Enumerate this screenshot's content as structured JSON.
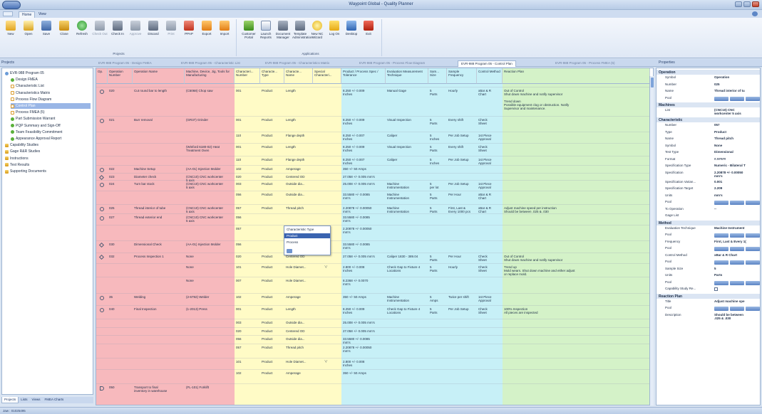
{
  "window": {
    "title": "Waypoint Global - Quality Planner"
  },
  "ribbon_tabs": [
    "Home",
    "View"
  ],
  "ribbon": {
    "projects_buttons": [
      {
        "label": "New",
        "icon": "new-folder-icon",
        "disabled": false
      },
      {
        "label": "Open",
        "icon": "open-folder-icon",
        "disabled": false
      },
      {
        "label": "Save",
        "icon": "save-icon",
        "disabled": false
      },
      {
        "label": "Close",
        "icon": "close-folder-icon",
        "disabled": false
      },
      {
        "label": "Refresh",
        "icon": "refresh-icon",
        "disabled": false
      },
      {
        "label": "Check Out",
        "icon": "check-out-icon",
        "disabled": true
      },
      {
        "label": "Check In",
        "icon": "check-in-icon",
        "disabled": false
      },
      {
        "label": "Approve",
        "icon": "approve-icon",
        "disabled": true
      },
      {
        "label": "Discard",
        "icon": "discard-icon",
        "disabled": false
      },
      {
        "label": "Print",
        "icon": "print-icon",
        "disabled": true
      },
      {
        "label": "PPAP",
        "icon": "ppap-icon",
        "disabled": false
      },
      {
        "label": "Export",
        "icon": "export-icon",
        "disabled": false
      },
      {
        "label": "Import",
        "icon": "import-icon",
        "disabled": false
      }
    ],
    "projects_group_label": "Projects",
    "applications_buttons": [
      {
        "label": "Customer Portal",
        "icon": "customer-portal-icon"
      },
      {
        "label": "Launch Reports",
        "icon": "launch-reports-icon"
      },
      {
        "label": "Document Manager",
        "icon": "document-manager-icon"
      },
      {
        "label": "Template Administration",
        "icon": "template-admin-icon"
      },
      {
        "label": "New NC Wizard",
        "icon": "nc-wizard-icon"
      },
      {
        "label": "Log On",
        "icon": "log-on-icon"
      },
      {
        "label": "Desktop",
        "icon": "desktop-icon"
      },
      {
        "label": "Exit",
        "icon": "exit-icon"
      }
    ],
    "applications_group_label": "Applications"
  },
  "projects_panel": {
    "header": "Projects",
    "tree": [
      {
        "label": "EVR-988 Program 05",
        "level": 0,
        "icon": "proj"
      },
      {
        "label": "Design FMEA",
        "level": 1,
        "icon": "green"
      },
      {
        "label": "Characteristic List",
        "level": 1,
        "icon": "doc"
      },
      {
        "label": "Characteristics Matrix",
        "level": 1,
        "icon": "doc"
      },
      {
        "label": "Process Flow Diagram",
        "level": 1,
        "icon": "doc"
      },
      {
        "label": "Control Plan",
        "level": 1,
        "icon": "doc",
        "selected": true
      },
      {
        "label": "Process FMEA (5)",
        "level": 1,
        "icon": "doc"
      },
      {
        "label": "Part Submission Warrant",
        "level": 1,
        "icon": "green"
      },
      {
        "label": "PQP Summary and Sign-Off",
        "level": 1,
        "icon": "green"
      },
      {
        "label": "Team Feasibility Commitment",
        "level": 1,
        "icon": "green"
      },
      {
        "label": "Appearance Approval Report",
        "level": 1,
        "icon": "green"
      },
      {
        "label": "Capability Studies",
        "level": 0,
        "icon": "folder"
      },
      {
        "label": "Gage R&R Studies",
        "level": 0,
        "icon": "folder"
      },
      {
        "label": "Instructions",
        "level": 0,
        "icon": "folder"
      },
      {
        "label": "Test Results",
        "level": 0,
        "icon": "folder"
      },
      {
        "label": "Supporting Documents",
        "level": 0,
        "icon": "folder"
      }
    ],
    "bottom_tabs": [
      "Projects",
      "Lists",
      "Views",
      "FMEA Charts"
    ]
  },
  "doc_tabs": [
    {
      "label": "EVR-988 Program 05 - Design FMEA",
      "active": false
    },
    {
      "label": "EVR-988 Program 05 - Characteristic List",
      "active": false
    },
    {
      "label": "EVR-988 Program 05 - Characteristics Matrix",
      "active": false
    },
    {
      "label": "EVR-988 Program 05 - Process Flow Diagram",
      "active": false
    },
    {
      "label": "EVR-988 Program 05 - Control Plan",
      "active": true
    },
    {
      "label": "EVR-988 Program 05 - Process FMEA (5)",
      "active": false
    }
  ],
  "grid": {
    "columns": [
      "Op.",
      "Operation Number",
      "Operation Name",
      "Machine, Device, Jig, Tools for Manufacturing",
      "Characteri... Number",
      "Characte... Type",
      "Characte... Name",
      "Special Characteri...",
      "Product / Process Spec / Tolerance",
      "Evaluation Measurement Technique",
      "Sam... Size",
      "Sample Frequency",
      "Control Method",
      "Reaction Plan"
    ],
    "rows": [
      {
        "mark": "circle",
        "opnum": "020",
        "opname": "Cut round bar to length",
        "machine": "(C5068) Chop saw",
        "charnum": "001",
        "type": "Product",
        "name": "Length",
        "special": "",
        "spec": "8.250 +/- 0.009\nInches",
        "eval": "Manual Gage",
        "size": "5\nParts",
        "freq": "Hourly",
        "control": "xBar & R\nChart",
        "reaction": "Out of Control\nShut down machine and notify supervisor\n\nTrend down\nPossible equipment clog or obstruction. Notify\nSupervisor and maintenance."
      },
      {
        "mark": "circle",
        "opnum": "021",
        "opname": "Burr removal",
        "machine": "(GR37) Grinder",
        "charnum": "001",
        "type": "Product",
        "name": "Length",
        "special": "",
        "spec": "8.250 +/- 0.009\nInches",
        "eval": "Visual Inspection",
        "size": "5\nParts",
        "freq": "Every shift",
        "control": "Check\nSheet",
        "reaction": ""
      },
      {
        "mark": "",
        "opnum": "",
        "opname": "",
        "machine": "",
        "charnum": "110",
        "type": "Product",
        "name": "Flange depth",
        "special": "",
        "spec": "8.250 +/- 0.007\nInches",
        "eval": "Caliper",
        "size": "5\nInches",
        "freq": "Per Job Setup",
        "control": "1st Piece\nApproval",
        "reaction": ""
      },
      {
        "mark": "",
        "opnum": "",
        "opname": "",
        "machine": "(Winford 6180-02) Heat\nTreatment Oven",
        "charnum": "001",
        "type": "Product",
        "name": "Length",
        "special": "",
        "spec": "8.250 +/- 0.009\nInches",
        "eval": "Visual Inspection",
        "size": "5\nParts",
        "freq": "Every shift",
        "control": "Check\nSheet",
        "reaction": ""
      },
      {
        "mark": "",
        "opnum": "",
        "opname": "",
        "machine": "",
        "charnum": "110",
        "type": "Product",
        "name": "Flange depth",
        "special": "",
        "spec": "8.250 +/- 0.007\nInches",
        "eval": "Caliper",
        "size": "5\nInches",
        "freq": "Per Job Setup",
        "control": "1st Piece\nApproval",
        "reaction": ""
      },
      {
        "mark": "circle",
        "opnum": "022",
        "opname": "Machine Setup",
        "machine": "(AA-01) Injection Molder",
        "charnum": "102",
        "type": "Product",
        "name": "Amperage",
        "special": "",
        "spec": "350 +/- 50 Amps",
        "eval": "",
        "size": "",
        "freq": "",
        "control": "",
        "reaction": ""
      },
      {
        "mark": "dia",
        "opnum": "023",
        "opname": "Diameter check",
        "machine": "(CNC10) CNC workcenter\n5 axis",
        "charnum": "020",
        "type": "Product",
        "name": "Centered OD",
        "special": "",
        "spec": "27.058 +/- 0.005 mm's",
        "eval": "",
        "size": "",
        "freq": "",
        "control": "",
        "reaction": ""
      },
      {
        "mark": "circle",
        "opnum": "024",
        "opname": "Turn bar stock",
        "machine": "(CNC10) CNC workcenter\n5 axis",
        "charnum": "003",
        "type": "Product",
        "name": "Outside dia...",
        "special": "",
        "spec": "25.008 +/- 0.005 mm's",
        "eval": "Machine\nInstrumentation",
        "size": "5\nper lot",
        "freq": "Per Job Setup",
        "control": "1st Piece\nApproval",
        "reaction": ""
      },
      {
        "mark": "",
        "opnum": "",
        "opname": "",
        "machine": "",
        "charnum": "056",
        "type": "Product",
        "name": "Outside dia...",
        "special": "",
        "spec": "33.5580 +/- 0.0085\nmm's",
        "eval": "Machine\nInstrumentation",
        "size": "5\nParts",
        "freq": "Per Hour",
        "control": "xBar & R\nChart",
        "reaction": ""
      },
      {
        "mark": "circle",
        "opnum": "025",
        "opname": "Thread interior of tube",
        "machine": "(CNC10) CNC workcenter\n5 axis",
        "charnum": "057",
        "type": "Product",
        "name": "Thread pitch",
        "special": "",
        "spec": "2.20878 +/- 0.00050\nmm's",
        "eval": "Machine\nInstrumentation",
        "size": "5\nParts",
        "freq": "First, Last &\nEvery 1000 pcs",
        "control": "xBar & R\nChart",
        "reaction": "Adjust machine speed per instruction\nShould be between .025 & .030"
      },
      {
        "mark": "circle",
        "opnum": "027",
        "opname": "Thread exterior end",
        "machine": "(CNC10) CNC workcenter\n5 axis",
        "charnum": "056",
        "type": "",
        "name": "",
        "special": "",
        "spec": "33.5580 +/- 0.0085\nmm's",
        "eval": "",
        "size": "",
        "freq": "",
        "control": "",
        "reaction": ""
      },
      {
        "mark": "",
        "opnum": "",
        "opname": "",
        "machine": "",
        "charnum": "057",
        "type": "",
        "name": "",
        "special": "",
        "spec": "2.20878 +/- 0.00050\nmm's",
        "eval": "",
        "size": "",
        "freq": "",
        "control": "",
        "reaction": ""
      },
      {
        "mark": "dia",
        "opnum": "030",
        "opname": "Dimensional Check",
        "machine": "(AA-01) Injection Molder",
        "charnum": "056",
        "type": "",
        "name": "",
        "special": "",
        "spec": "33.5580 +/- 0.0085\nmm's",
        "eval": "",
        "size": "",
        "freq": "",
        "control": "",
        "reaction": ""
      },
      {
        "mark": "dia",
        "opnum": "032",
        "opname": "Process Inspection 1",
        "machine": "None",
        "charnum": "020",
        "type": "Product",
        "name": "Centered OD",
        "special": "",
        "spec": "27.058 +/- 0.005 mm's",
        "eval": "Caliper 1830 - 389.04",
        "size": "5\nParts",
        "freq": "Per Hour",
        "control": "Check\nSheet",
        "reaction": "Out of Control\nShut down machine and notify supervisor"
      },
      {
        "mark": "",
        "opnum": "",
        "opname": "",
        "machine": "None",
        "charnum": "101",
        "type": "Product",
        "name": "Hole Diamet...",
        "special": "▽",
        "spec": "2.800 +/- 0.008\nInches",
        "eval": "Check Gap to Fixture 4\nLocations",
        "size": "5\nParts",
        "freq": "Hourly",
        "control": "Check\nSheet",
        "reaction": "Trend up\nMold wears. Shut down machine and either adjust\nor replace mold."
      },
      {
        "mark": "",
        "opnum": "",
        "opname": "",
        "machine": "None",
        "charnum": "007",
        "type": "Product",
        "name": "Hole Diamet...",
        "special": "",
        "spec": "8.2368 +/- 0.0070\nmm's",
        "eval": "",
        "size": "",
        "freq": "",
        "control": "",
        "reaction": ""
      },
      {
        "mark": "circle",
        "opnum": "35",
        "opname": "Welding",
        "machine": "(2-6792) Welder",
        "charnum": "102",
        "type": "Product",
        "name": "Amperage",
        "special": "",
        "spec": "350 +/- 50 Amps",
        "eval": "Machine\nInstrumentation",
        "size": "5\nAmps",
        "freq": "Twice per shift",
        "control": "1st Piece\nApproval",
        "reaction": ""
      },
      {
        "mark": "circle",
        "opnum": "040",
        "opname": "Final Inspection",
        "machine": "(1-2013) Press",
        "charnum": "001",
        "type": "Product",
        "name": "Length",
        "special": "",
        "spec": "8.250 +/- 0.009\nInches",
        "eval": "Check Gap to Fixture 4\nLocations",
        "size": "5\nParts",
        "freq": "Per Job Setup",
        "control": "Check\nSheet",
        "reaction": "100% Inspection\nAll pieces are inspected"
      },
      {
        "mark": "",
        "opnum": "",
        "opname": "",
        "machine": "",
        "charnum": "003",
        "type": "Product",
        "name": "Outside dia...",
        "special": "",
        "spec": "25.008 +/- 0.005 mm's",
        "eval": "",
        "size": "",
        "freq": "",
        "control": "",
        "reaction": ""
      },
      {
        "mark": "",
        "opnum": "",
        "opname": "",
        "machine": "",
        "charnum": "020",
        "type": "Product",
        "name": "Centered OD",
        "special": "",
        "spec": "27.058 +/- 0.005 mm's",
        "eval": "",
        "size": "",
        "freq": "",
        "control": "",
        "reaction": ""
      },
      {
        "mark": "",
        "opnum": "",
        "opname": "",
        "machine": "",
        "charnum": "056",
        "type": "Product",
        "name": "Outside dia...",
        "special": "",
        "spec": "33.5580 +/- 0.0085\nmm's",
        "eval": "",
        "size": "",
        "freq": "",
        "control": "",
        "reaction": ""
      },
      {
        "mark": "",
        "opnum": "",
        "opname": "",
        "machine": "",
        "charnum": "057",
        "type": "Product",
        "name": "Thread pitch",
        "special": "",
        "spec": "2.20878 +/- 0.00050\nmm's",
        "eval": "",
        "size": "",
        "freq": "",
        "control": "",
        "reaction": ""
      },
      {
        "mark": "",
        "opnum": "",
        "opname": "",
        "machine": "",
        "charnum": "101",
        "type": "Product",
        "name": "Hole Diamet...",
        "special": "▽",
        "spec": "2.800 +/- 0.008\nInches",
        "eval": "",
        "size": "",
        "freq": "",
        "control": "",
        "reaction": ""
      },
      {
        "mark": "",
        "opnum": "",
        "opname": "",
        "machine": "",
        "charnum": "102",
        "type": "Product",
        "name": "Amperage",
        "special": "",
        "spec": "350 +/- 50 Amps",
        "eval": "",
        "size": "",
        "freq": "",
        "control": "",
        "reaction": ""
      },
      {
        "mark": "tag",
        "opnum": "050",
        "opname": "Transport to final\ninventory in warehouse",
        "machine": "(FL-101) Forklift",
        "charnum": "",
        "type": "",
        "name": "",
        "special": "",
        "spec": "",
        "eval": "",
        "size": "",
        "freq": "",
        "control": "",
        "reaction": ""
      }
    ],
    "dropdown": {
      "title": "Characteristic Type",
      "options": [
        "Product",
        "Process"
      ],
      "selected": "Product"
    }
  },
  "properties": {
    "header": "Properties",
    "sections": [
      {
        "title": "Operation",
        "rows": [
          {
            "key": "Symbol",
            "value": "Operation"
          },
          {
            "key": "Number",
            "value": "025"
          },
          {
            "key": "Name",
            "value": "Thread interior of tu"
          },
          {
            "key": "Pool",
            "value": "",
            "buttons": true
          }
        ]
      },
      {
        "title": "Machines",
        "rows": [
          {
            "key": "List",
            "value": "(CNC10) CNC\nworkcenter 5 axis"
          }
        ]
      },
      {
        "title": "Characteristic",
        "rows": [
          {
            "key": "Number",
            "value": "057"
          },
          {
            "key": "Type",
            "value": "Product"
          },
          {
            "key": "Name",
            "value": "Thread pitch"
          },
          {
            "key": "Symbol",
            "value": "None"
          },
          {
            "key": "Test Type",
            "value": "Dimensional"
          },
          {
            "key": "Format",
            "value": "#.#####"
          },
          {
            "key": "Specification Type",
            "value": "Numeric - Bilateral T"
          },
          {
            "key": "Specification",
            "value": "2.20878 +/- 0.00050\nmm's"
          },
          {
            "key": "Specification Varian...",
            "value": "0.001"
          },
          {
            "key": "Specification Target",
            "value": "2.209"
          },
          {
            "key": "Units",
            "value": "mm's"
          },
          {
            "key": "Pool",
            "value": "",
            "buttons": true
          },
          {
            "key": "To Operation",
            "value": "--"
          },
          {
            "key": "Gage List",
            "value": ""
          }
        ]
      },
      {
        "title": "Method",
        "rows": [
          {
            "key": "Evaluation Technique",
            "value": "Machine Instrument"
          },
          {
            "key": "Pool",
            "value": "",
            "buttons": true
          },
          {
            "key": "Frequency",
            "value": "First, Last & Every 1("
          },
          {
            "key": "Pool",
            "value": "",
            "buttons": true
          },
          {
            "key": "Control Method",
            "value": "xBar & R Chart"
          },
          {
            "key": "Pool",
            "value": "",
            "buttons": true
          },
          {
            "key": "Sample Size",
            "value": "5"
          },
          {
            "key": "Units",
            "value": "Parts"
          },
          {
            "key": "Pool",
            "value": "",
            "buttons": true
          },
          {
            "key": "Capability Study Re...",
            "value": "",
            "check": true
          }
        ]
      },
      {
        "title": "Reaction Plan",
        "rows": [
          {
            "key": "Title",
            "value": "Adjust machine spe"
          },
          {
            "key": "Pool",
            "value": "",
            "buttons": true
          },
          {
            "key": "Description",
            "value": "Should be between\n.025 & .030"
          }
        ]
      }
    ]
  },
  "status": {
    "text": "Jaw : 01025495"
  },
  "colors": {
    "pink": "#f7b9bd",
    "yellow": "#fffbc6",
    "cyan": "#c7f0f7",
    "green": "#d4f2c8",
    "ribbon": "#dfe8f5"
  }
}
